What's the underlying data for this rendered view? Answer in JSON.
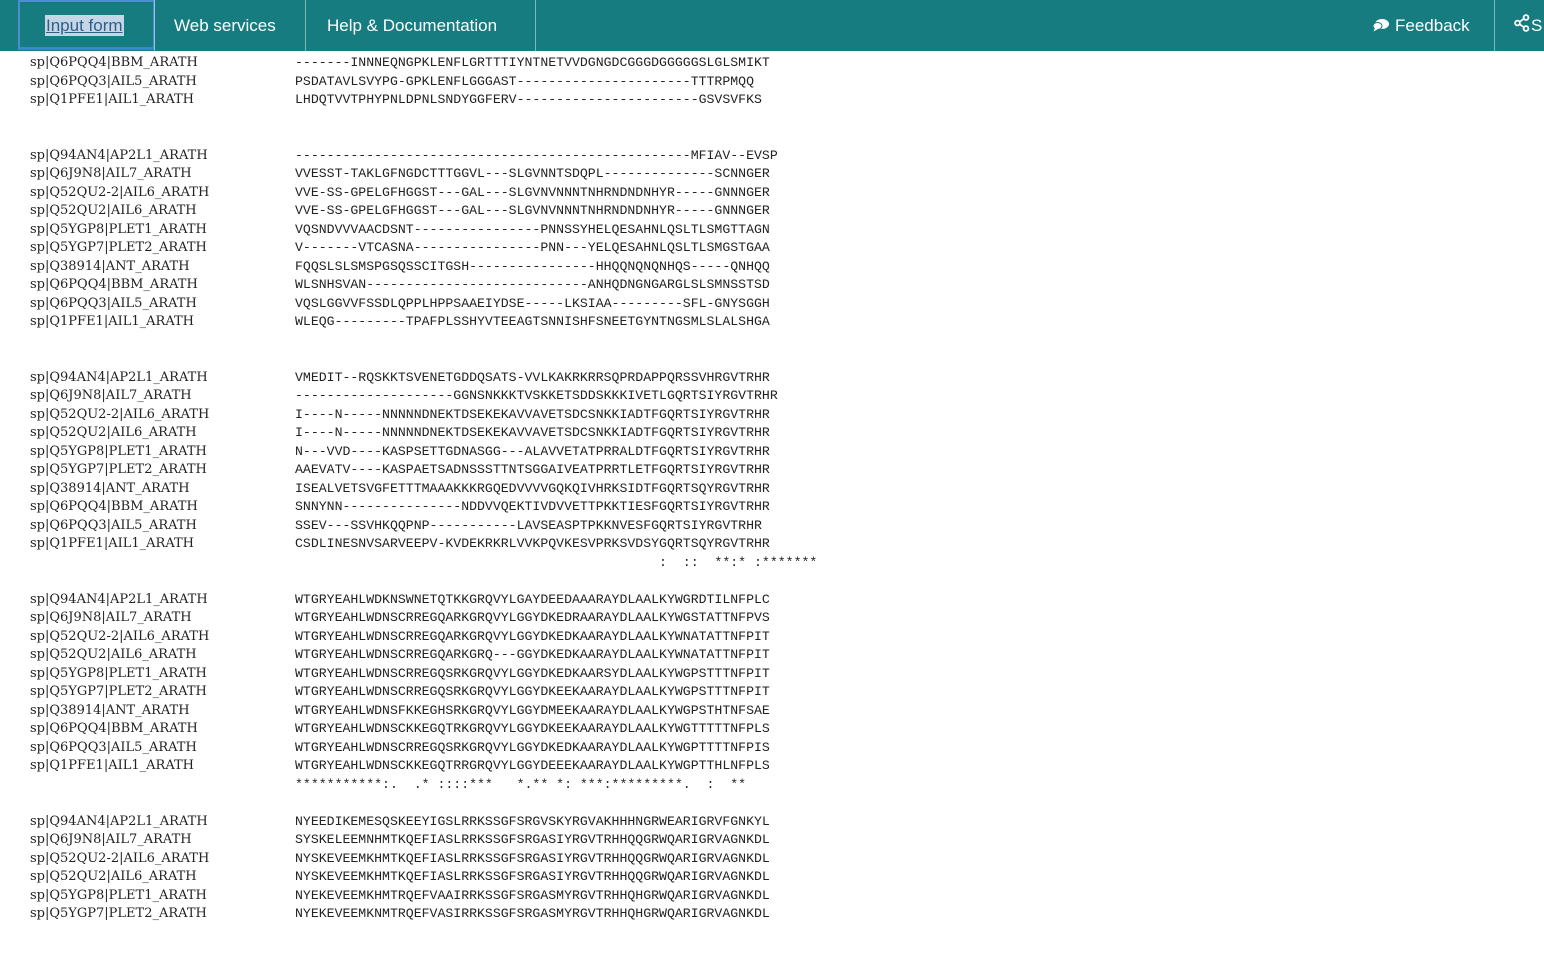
{
  "nav": {
    "input_form": "Input form",
    "web_services": "Web services",
    "help_docs": "Help & Documentation",
    "feedback": "Feedback",
    "share": "S",
    "feedback_icon": "speech-bubble-icon",
    "share_icon": "share-icon"
  },
  "colors": {
    "topbar": "#167c80",
    "active_outline": "#4c8fd0"
  },
  "blocks": [
    {
      "rows": [
        {
          "name": "sp|Q6PQQ4|BBM_ARATH",
          "seq": "-------INNNEQNGPKLENFLGRTTTIYNTNETVVDGNGDCGGGDGGGGGSLGLSMIKT"
        },
        {
          "name": "sp|Q6PQQ3|AIL5_ARATH",
          "seq": "PSDATAVLSVYPG-GPKLENFLGGGAST----------------------TTTRPMQQ"
        },
        {
          "name": "sp|Q1PFE1|AIL1_ARATH",
          "seq": "LHDQTVVTPHYPNLDPNLSNDYGGFERV-----------------------GSVSVFKS"
        }
      ],
      "consensus": ""
    },
    {
      "rows": [
        {
          "name": "sp|Q94AN4|AP2L1_ARATH",
          "seq": "--------------------------------------------------MFIAV--EVSP"
        },
        {
          "name": "sp|Q6J9N8|AIL7_ARATH",
          "seq": "VVESST-TAKLGFNGDCTTTGGVL---SLGVNNTSDQPL--------------SCNNGER"
        },
        {
          "name": "sp|Q52QU2-2|AIL6_ARATH",
          "seq": "VVE-SS-GPELGFHGGST---GAL---SLGVNVNNNTNHRNDNDNHYR-----GNNNGER"
        },
        {
          "name": "sp|Q52QU2|AIL6_ARATH",
          "seq": "VVE-SS-GPELGFHGGST---GAL---SLGVNVNNNTNHRNDNDNHYR-----GNNNGER"
        },
        {
          "name": "sp|Q5YGP8|PLET1_ARATH",
          "seq": "VQSNDVVVAACDSNT----------------PNNSSYHELQESAHNLQSLTLSMGTTAGN"
        },
        {
          "name": "sp|Q5YGP7|PLET2_ARATH",
          "seq": "V-------VTCASNA----------------PNN---YELQESAHNLQSLTLSMGSTGAA"
        },
        {
          "name": "sp|Q38914|ANT_ARATH",
          "seq": "FQQSLSLSMSPGSQSSCITGSH----------------HHQQNQNQNHQS-----QNHQQ"
        },
        {
          "name": "sp|Q6PQQ4|BBM_ARATH",
          "seq": "WLSNHSVAN----------------------------ANHQDNGNGARGLSLSMNSSTSD"
        },
        {
          "name": "sp|Q6PQQ3|AIL5_ARATH",
          "seq": "VQSLGGVVFSSDLQPPLHPPSAAEIYDSE-----LKSIAA---------SFL-GNYSGGH"
        },
        {
          "name": "sp|Q1PFE1|AIL1_ARATH",
          "seq": "WLEQG---------TPAFPLSSHYVTEEAGTSNNISHFSNEETGYNTNGSMLSLALSHGA"
        }
      ],
      "consensus": ""
    },
    {
      "rows": [
        {
          "name": "sp|Q94AN4|AP2L1_ARATH",
          "seq": "VMEDIT--RQSKKTSVENETGDDQSATS-VVLKAKRKRRSQPRDAPPQRSSVHRGVTRHR"
        },
        {
          "name": "sp|Q6J9N8|AIL7_ARATH",
          "seq": "--------------------GGNSNKKKTVSKKETSDDSKKKIVETLGQRTSIYRGVTRHR"
        },
        {
          "name": "sp|Q52QU2-2|AIL6_ARATH",
          "seq": "I----N-----NNNNNDNEKTDSEKEKAVVAVETSDCSNKKIADTFGQRTSIYRGVTRHR"
        },
        {
          "name": "sp|Q52QU2|AIL6_ARATH",
          "seq": "I----N-----NNNNNDNEKTDSEKEKAVVAVETSDCSNKKIADTFGQRTSIYRGVTRHR"
        },
        {
          "name": "sp|Q5YGP8|PLET1_ARATH",
          "seq": "N---VVD----KASPSETTGDNASGG---ALAVVETATPRRALDTFGQRTSIYRGVTRHR"
        },
        {
          "name": "sp|Q5YGP7|PLET2_ARATH",
          "seq": "AAEVATV----KASPAETSADNSSSTTNTSGGAIVEATPRRTLETFGQRTSIYRGVTRHR"
        },
        {
          "name": "sp|Q38914|ANT_ARATH",
          "seq": "ISEALVETSVGFETTTMAAAKKKRGQEDVVVVGQKQIVHRKSIDTFGQRTSQYRGVTRHR"
        },
        {
          "name": "sp|Q6PQQ4|BBM_ARATH",
          "seq": "SNNYNN---------------NDDVVQEKTIVDVVETTPKKTIESFGQRTSIYRGVTRHR"
        },
        {
          "name": "sp|Q6PQQ3|AIL5_ARATH",
          "seq": "SSEV---SSVHKQQPNP-----------LAVSEASPTPKKNVESFGQRTSIYRGVTRHR"
        },
        {
          "name": "sp|Q1PFE1|AIL1_ARATH",
          "seq": "CSDLINESNVSARVEEPV-KVDEKRKRLVVKPQVKESVPRKSVDSYGQRTSQYRGVTRHR"
        }
      ],
      "consensus": "                                              :  ::  **:* :*******"
    },
    {
      "rows": [
        {
          "name": "sp|Q94AN4|AP2L1_ARATH",
          "seq": "WTGRYEAHLWDKNSWNETQTKKGRQVYLGAYDEEDAAARAYDLAALKYWGRDTILNFPLC"
        },
        {
          "name": "sp|Q6J9N8|AIL7_ARATH",
          "seq": "WTGRYEAHLWDNSCRREGQARKGRQVYLGGYDKEDRAARAYDLAALKYWGSTATTNFPVS"
        },
        {
          "name": "sp|Q52QU2-2|AIL6_ARATH",
          "seq": "WTGRYEAHLWDNSCRREGQARKGRQVYLGGYDKEDKAARAYDLAALKYWNATATTNFPIT"
        },
        {
          "name": "sp|Q52QU2|AIL6_ARATH",
          "seq": "WTGRYEAHLWDNSCRREGQARKGRQ---GGYDKEDKAARAYDLAALKYWNATATTNFPIT"
        },
        {
          "name": "sp|Q5YGP8|PLET1_ARATH",
          "seq": "WTGRYEAHLWDNSCRREGQSRKGRQVYLGGYDKEDKAARSYDLAALKYWGPSTTTNFPIT"
        },
        {
          "name": "sp|Q5YGP7|PLET2_ARATH",
          "seq": "WTGRYEAHLWDNSCRREGQSRKGRQVYLGGYDKEEKAARAYDLAALKYWGPSTTTNFPIT"
        },
        {
          "name": "sp|Q38914|ANT_ARATH",
          "seq": "WTGRYEAHLWDNSFKKEGHSRKGRQVYLGGYDMEEKAARAYDLAALKYWGPSTHTNFSAE"
        },
        {
          "name": "sp|Q6PQQ4|BBM_ARATH",
          "seq": "WTGRYEAHLWDNSCKKEGQTRKGRQVYLGGYDKEEKAARAYDLAALKYWGTTTTTNFPLS"
        },
        {
          "name": "sp|Q6PQQ3|AIL5_ARATH",
          "seq": "WTGRYEAHLWDNSCRREGQSRKGRQVYLGGYDKEDKAARAYDLAALKYWGPTTTTNFPIS"
        },
        {
          "name": "sp|Q1PFE1|AIL1_ARATH",
          "seq": "WTGRYEAHLWDNSCKKEGQTRRGRQVYLGGYDEEEKAARAYDLAALKYWGPTTHLNFPLS"
        }
      ],
      "consensus": "***********:.  .* ::::***   *.** *: ***:*********.  :  **"
    },
    {
      "rows": [
        {
          "name": "sp|Q94AN4|AP2L1_ARATH",
          "seq": "NYEEDIKEMESQSKEEYIGSLRRKSSGFSRGVSKYRGVAKHHHNGRWEARIGRVFGNKYL"
        },
        {
          "name": "sp|Q6J9N8|AIL7_ARATH",
          "seq": "SYSKELEEMNHMTKQEFIASLRRKSSGFSRGASIYRGVTRHHQQGRWQARIGRVAGNKDL"
        },
        {
          "name": "sp|Q52QU2-2|AIL6_ARATH",
          "seq": "NYSKEVEEMKHMTKQEFIASLRRKSSGFSRGASIYRGVTRHHQQGRWQARIGRVAGNKDL"
        },
        {
          "name": "sp|Q52QU2|AIL6_ARATH",
          "seq": "NYSKEVEEMKHMTKQEFIASLRRKSSGFSRGASIYRGVTRHHQQGRWQARIGRVAGNKDL"
        },
        {
          "name": "sp|Q5YGP8|PLET1_ARATH",
          "seq": "NYEKEVEEMKHMTRQEFVAAIRRKSSGFSRGASMYRGVTRHHQHGRWQARIGRVAGNKDL"
        },
        {
          "name": "sp|Q5YGP7|PLET2_ARATH",
          "seq": "NYEKEVEEMKNMTRQEFVASIRRKSSGFSRGASMYRGVTRHHQHGRWQARIGRVAGNKDL"
        }
      ],
      "consensus": ""
    }
  ]
}
